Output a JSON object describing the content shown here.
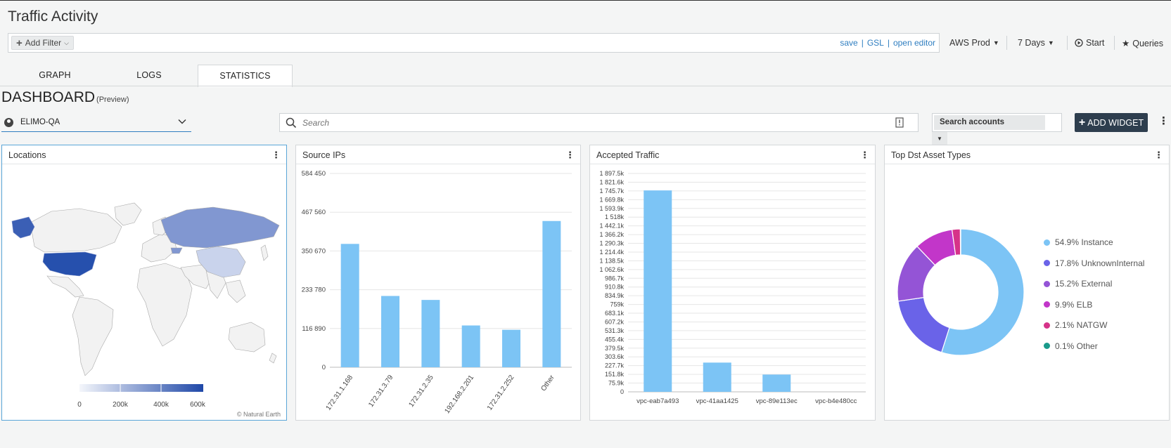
{
  "header": {
    "title": "Traffic Activity"
  },
  "filter_bar": {
    "add_filter_label": "Add Filter",
    "links": [
      "save",
      "GSL",
      "open editor"
    ],
    "separator": "|"
  },
  "top_controls": {
    "environment": "AWS Prod",
    "time_range": "7 Days",
    "start_label": "Start",
    "queries_label": "Queries"
  },
  "tabs": [
    {
      "label": "GRAPH",
      "active": false
    },
    {
      "label": "LOGS",
      "active": false
    },
    {
      "label": "STATISTICS",
      "active": true
    }
  ],
  "dashboard": {
    "title": "DASHBOARD",
    "subtitle": "(Preview)",
    "account": "ELIMO-QA",
    "search_placeholder": "Search",
    "search_accounts_label": "Search accounts",
    "add_widget_label": "ADD WIDGET"
  },
  "widgets": {
    "locations": {
      "title": "Locations",
      "scale_ticks": [
        "0",
        "200k",
        "400k",
        "600k"
      ],
      "attribution": "© Natural Earth",
      "colors": {
        "low": "#e8ecf6",
        "high": "#1f48a8"
      }
    },
    "source_ips": {
      "title": "Source IPs"
    },
    "accepted_traffic": {
      "title": "Accepted Traffic"
    },
    "top_dst": {
      "title": "Top Dst Asset Types"
    }
  },
  "chart_data": [
    {
      "type": "bar",
      "categories": [
        "172.31.1.168",
        "172.31.3.79",
        "172.31.2.35",
        "192.168.2.201",
        "172.31.2.252",
        "Other"
      ],
      "values": [
        372000,
        215000,
        203000,
        126000,
        113000,
        441000
      ],
      "title": "Source IPs",
      "yticks": [
        "0",
        "116 890",
        "233 780",
        "350 670",
        "467 560",
        "584 450"
      ],
      "ylim": [
        0,
        584450
      ],
      "grid": true,
      "color": "#7cc4f5"
    },
    {
      "type": "bar",
      "categories": [
        "vpc-eab7a493",
        "vpc-41aa1425",
        "vpc-89e113ec",
        "vpc-b4e480cc"
      ],
      "values": [
        1750000,
        254000,
        150000,
        0
      ],
      "title": "Accepted Traffic",
      "yticks": [
        "0",
        "75.9k",
        "151.8k",
        "227.7k",
        "303.6k",
        "379.5k",
        "455.4k",
        "531.3k",
        "607.2k",
        "683.1k",
        "759k",
        "834.9k",
        "910.8k",
        "986.7k",
        "1 062.6k",
        "1 138.5k",
        "1 214.4k",
        "1 290.3k",
        "1 366.2k",
        "1 442.1k",
        "1 518k",
        "1 593.9k",
        "1 669.8k",
        "1 745.7k",
        "1 821.6k",
        "1 897.5k"
      ],
      "ylim": [
        0,
        1897500
      ],
      "grid": true,
      "color": "#7cc4f5"
    },
    {
      "type": "pie",
      "title": "Top Dst Asset Types",
      "slices": [
        {
          "label": "54.9% Instance",
          "value": 54.9,
          "color": "#7cc4f5"
        },
        {
          "label": "17.8% UnknownInternal",
          "value": 17.8,
          "color": "#6a63e8"
        },
        {
          "label": "15.2% External",
          "value": 15.2,
          "color": "#9454d6"
        },
        {
          "label": "9.9% ELB",
          "value": 9.9,
          "color": "#c236c9"
        },
        {
          "label": "2.1% NATGW",
          "value": 2.1,
          "color": "#d63389"
        },
        {
          "label": "0.1% Other",
          "value": 0.1,
          "color": "#1a9a8a"
        }
      ]
    }
  ]
}
